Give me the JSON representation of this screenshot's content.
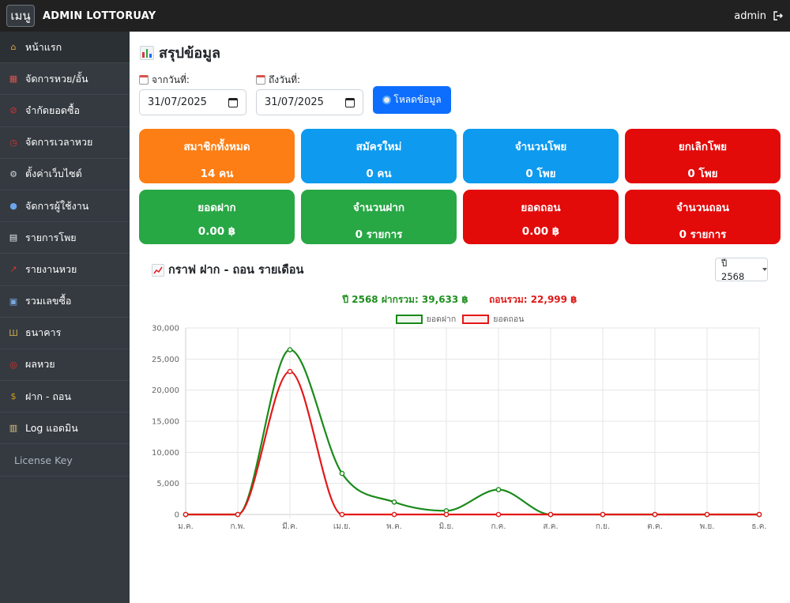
{
  "topbar": {
    "menu_label": "เมนู",
    "brand": "ADMIN LOTTORUAY",
    "user": "admin"
  },
  "sidebar": {
    "items": [
      {
        "label": "หน้าแรก",
        "icon": "home-icon",
        "active": true
      },
      {
        "label": "จัดการหวย/อั้น",
        "icon": "calendar-icon"
      },
      {
        "label": "จำกัดยอดซื้อ",
        "icon": "no-entry-icon"
      },
      {
        "label": "จัดการเวลาหวย",
        "icon": "alarm-clock-icon"
      },
      {
        "label": "ตั้งค่าเว็บไซต์",
        "icon": "gear-icon"
      },
      {
        "label": "จัดการผู้ใช้งาน",
        "icon": "user-icon"
      },
      {
        "label": "รายการโพย",
        "icon": "document-icon"
      },
      {
        "label": "รายงานหวย",
        "icon": "chart-icon"
      },
      {
        "label": "รวมเลขซื้อ",
        "icon": "numbers-icon"
      },
      {
        "label": "ธนาคาร",
        "icon": "bank-icon"
      },
      {
        "label": "ผลหวย",
        "icon": "dart-icon"
      },
      {
        "label": "ฝาก - ถอน",
        "icon": "money-bag-icon"
      },
      {
        "label": "Log แอดมิน",
        "icon": "clipboard-icon"
      },
      {
        "label": "License Key",
        "icon": ""
      }
    ]
  },
  "page": {
    "title": "สรุปข้อมูล",
    "from_label": "จากวันที่:",
    "from_value": "31/07/2025",
    "to_label": "ถึงวันที่:",
    "to_value": "31/07/2025",
    "load_button": "โหลดข้อมูล"
  },
  "cards": [
    {
      "title": "สมาชิกทั้งหมด",
      "value": "14 คน",
      "color": "#fd7e14"
    },
    {
      "title": "สมัครใหม่",
      "value": "0 คน",
      "color": "#0d9aef"
    },
    {
      "title": "จำนวนโพย",
      "value": "0 โพย",
      "color": "#0d9aef"
    },
    {
      "title": "ยกเลิกโพย",
      "value": "0 โพย",
      "color": "#e30a0a"
    },
    {
      "title": "ยอดฝาก",
      "value": "0.00 ฿",
      "color": "#28a745"
    },
    {
      "title": "จำนวนฝาก",
      "value": "0 รายการ",
      "color": "#28a745"
    },
    {
      "title": "ยอดถอน",
      "value": "0.00 ฿",
      "color": "#e30a0a"
    },
    {
      "title": "จำนวนถอน",
      "value": "0 รายการ",
      "color": "#e30a0a"
    }
  ],
  "chart_section": {
    "title": "กราฟ ฝาก - ถอน รายเดือน",
    "year_select": "ปี 2568",
    "summary_deposit": "ปี 2568 ฝากรวม: 39,633 ฿",
    "summary_withdraw": "ถอนรวม: 22,999 ฿"
  },
  "chart_data": {
    "type": "line",
    "categories": [
      "ม.ค.",
      "ก.พ.",
      "มี.ค.",
      "เม.ย.",
      "พ.ค.",
      "มิ.ย.",
      "ก.ค.",
      "ส.ค.",
      "ก.ย.",
      "ต.ค.",
      "พ.ย.",
      "ธ.ค."
    ],
    "series": [
      {
        "name": "ยอดฝาก",
        "color": "#1a8a1a",
        "values": [
          0,
          0,
          26500,
          6600,
          2000,
          600,
          4000,
          0,
          0,
          0,
          0,
          0
        ]
      },
      {
        "name": "ยอดถอน",
        "color": "#e31818",
        "values": [
          0,
          0,
          23000,
          0,
          0,
          0,
          0,
          0,
          0,
          0,
          0,
          0
        ]
      }
    ],
    "yticks": [
      "0",
      "5,000",
      "10,000",
      "15,000",
      "20,000",
      "25,000",
      "30,000"
    ],
    "ylim": [
      0,
      30000
    ],
    "grid": true,
    "legend": "top-center"
  }
}
